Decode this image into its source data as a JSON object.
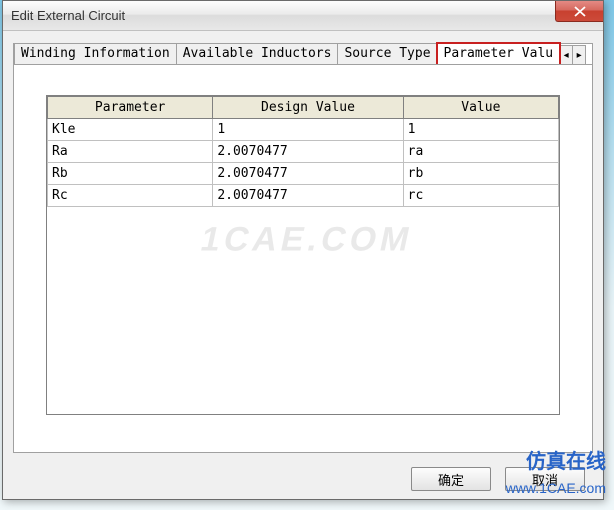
{
  "window": {
    "title": "Edit External Circuit"
  },
  "tabs": {
    "t0": "Winding Information",
    "t1": "Available Inductors",
    "t2": "Source Type",
    "t3": "Parameter Valu"
  },
  "grid": {
    "headers": {
      "h0": "Parameter",
      "h1": "Design Value",
      "h2": "Value"
    },
    "rows": [
      {
        "p": "Kle",
        "d": "1",
        "v": "1"
      },
      {
        "p": "Ra",
        "d": "2.0070477",
        "v": "ra"
      },
      {
        "p": "Rb",
        "d": "2.0070477",
        "v": "rb"
      },
      {
        "p": "Rc",
        "d": "2.0070477",
        "v": "rc"
      }
    ]
  },
  "buttons": {
    "ok": "确定",
    "cancel": "取消"
  },
  "watermark": {
    "center": "1CAE.COM",
    "br1": "仿真在线",
    "br2": "www.1CAE.com"
  }
}
